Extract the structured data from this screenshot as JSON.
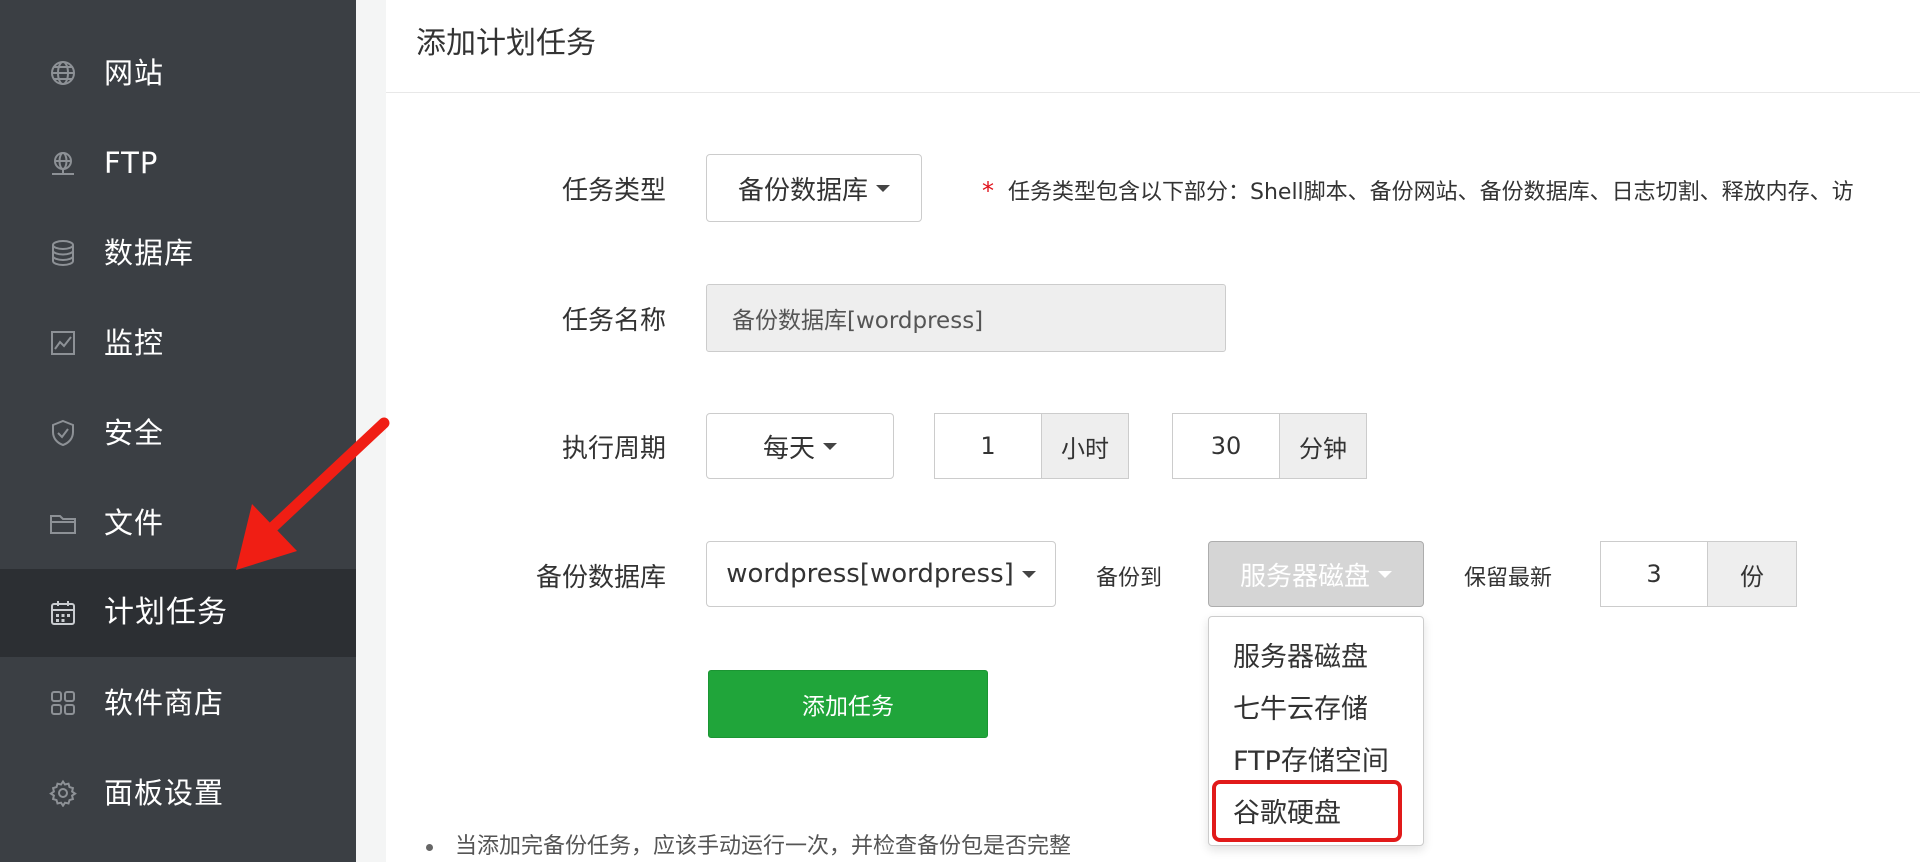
{
  "sidebar": {
    "items": [
      {
        "label": "网站",
        "icon": "globe-icon"
      },
      {
        "label": "FTP",
        "icon": "ftp-server-icon"
      },
      {
        "label": "数据库",
        "icon": "database-icon"
      },
      {
        "label": "监控",
        "icon": "monitor-chart-icon"
      },
      {
        "label": "安全",
        "icon": "shield-icon"
      },
      {
        "label": "文件",
        "icon": "folder-icon"
      },
      {
        "label": "计划任务",
        "icon": "calendar-icon",
        "active": true
      },
      {
        "label": "软件商店",
        "icon": "grid-apps-icon"
      },
      {
        "label": "面板设置",
        "icon": "gear-icon"
      }
    ]
  },
  "page": {
    "title": "添加计划任务"
  },
  "form": {
    "task_type": {
      "label": "任务类型",
      "value": "备份数据库",
      "hint": "任务类型包含以下部分：Shell脚本、备份网站、备份数据库、日志切割、释放内存、访"
    },
    "task_name": {
      "label": "任务名称",
      "value": "备份数据库[wordpress]"
    },
    "cycle": {
      "label": "执行周期",
      "period": "每天",
      "hour_value": "1",
      "hour_unit": "小时",
      "minute_value": "30",
      "minute_unit": "分钟"
    },
    "backup_db": {
      "label": "备份数据库",
      "database": "wordpress[wordpress]",
      "to_label": "备份到",
      "destination": "服务器磁盘",
      "keep_label": "保留最新",
      "keep_value": "3",
      "keep_unit": "份"
    },
    "submit_label": "添加任务"
  },
  "dropdown": {
    "options": [
      "服务器磁盘",
      "七牛云存储",
      "FTP存储空间",
      "谷歌硬盘"
    ],
    "highlighted": "谷歌硬盘"
  },
  "note": "当添加完备份任务，应该手动运行一次，并检查备份包是否完整",
  "colors": {
    "sidebar_bg": "#3b3f44",
    "sidebar_active": "#2c2f33",
    "submit_green": "#20a53a",
    "annotation_red": "#e11a1a",
    "required_star": "#e0101a"
  }
}
